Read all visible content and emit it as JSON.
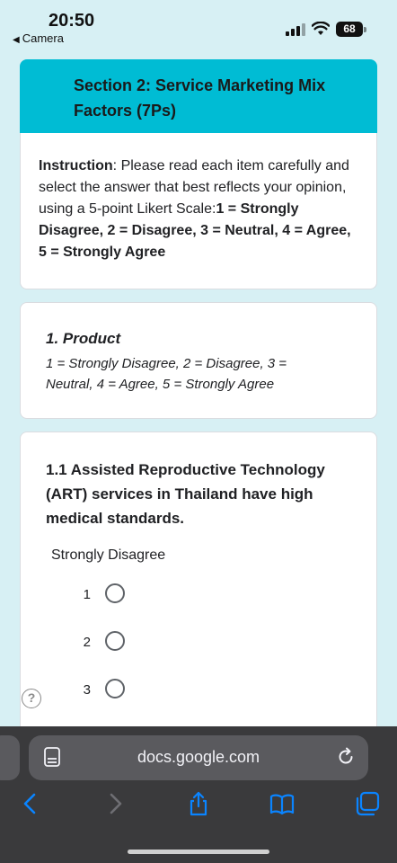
{
  "status_bar": {
    "time": "20:50",
    "back_app": "Camera",
    "battery": "68"
  },
  "form": {
    "section_title": "Section 2: Service Marketing Mix Factors (7Ps)",
    "instruction": {
      "label": "Instruction",
      "text_plain": ": Please read each item carefully and select the answer that best reflects your opinion, using a 5-point Likert Scale:",
      "scale_bold": "1 = Strongly Disagree, 2 = Disagree, 3 = Neutral, 4 = Agree, 5 = Strongly Agree"
    },
    "product": {
      "title": "1. Product",
      "description": "1 = Strongly Disagree, 2 = Disagree, 3 = Neutral, 4 = Agree, 5 = Strongly Agree"
    },
    "question": {
      "text": "1.1 Assisted Reproductive Technology (ART) services in Thailand have high medical standards.",
      "low_label": "Strongly Disagree",
      "options": [
        "1",
        "2",
        "3"
      ]
    },
    "help_icon": "?"
  },
  "browser": {
    "url": "docs.google.com"
  },
  "colors": {
    "page_bg": "#d7f0f4",
    "header_bg": "#00bcd4",
    "card_bg": "#ffffff",
    "browser_bar": "#3a3a3c",
    "accent_blue": "#0a84ff"
  }
}
